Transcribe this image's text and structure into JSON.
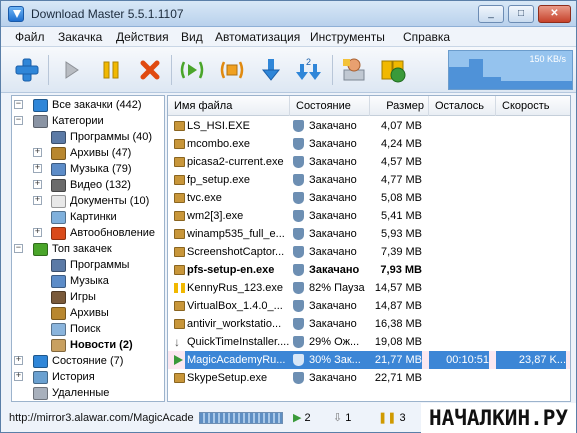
{
  "window": {
    "title": "Download Master 5.5.1.1107"
  },
  "titlebar_buttons": {
    "minimize": "_",
    "maximize": "□",
    "close": "✕"
  },
  "menu": [
    "Файл",
    "Закачка",
    "Действия",
    "Вид",
    "Автоматизация",
    "Инструменты",
    "Справка"
  ],
  "toolbar": {
    "icons": [
      "add-icon",
      "resume-icon",
      "pause-icon",
      "delete-icon",
      "start-all-icon",
      "stop-all-icon",
      "download-icon",
      "download-queue-icon",
      "site-manager-icon",
      "scheduler-icon"
    ]
  },
  "speed": {
    "label": "150 KB/s"
  },
  "tree": {
    "items": [
      {
        "label": "Все закачки (442)",
        "icon": "all-downloads-icon",
        "expander": "−",
        "level": 0,
        "bold": false
      },
      {
        "label": "Категории",
        "icon": "categories-icon",
        "expander": "−",
        "level": 0,
        "bold": false
      },
      {
        "label": "Программы (40)",
        "icon": "programs-icon",
        "expander": "",
        "level": 1,
        "bold": false
      },
      {
        "label": "Архивы (47)",
        "icon": "archives-icon",
        "expander": "+",
        "level": 1,
        "bold": false
      },
      {
        "label": "Музыка (79)",
        "icon": "music-icon",
        "expander": "+",
        "level": 1,
        "bold": false
      },
      {
        "label": "Видео (132)",
        "icon": "video-icon",
        "expander": "+",
        "level": 1,
        "bold": false
      },
      {
        "label": "Документы (10)",
        "icon": "documents-icon",
        "expander": "+",
        "level": 1,
        "bold": false
      },
      {
        "label": "Картинки",
        "icon": "pictures-icon",
        "expander": "",
        "level": 1,
        "bold": false
      },
      {
        "label": "Автообновление",
        "icon": "autoupdate-icon",
        "expander": "+",
        "level": 1,
        "bold": false
      },
      {
        "label": "Топ закачек",
        "icon": "top-downloads-icon",
        "expander": "−",
        "level": 0,
        "bold": false
      },
      {
        "label": "Программы",
        "icon": "programs-icon",
        "expander": "",
        "level": 1,
        "bold": false
      },
      {
        "label": "Музыка",
        "icon": "music-icon",
        "expander": "",
        "level": 1,
        "bold": false
      },
      {
        "label": "Игры",
        "icon": "games-icon",
        "expander": "",
        "level": 1,
        "bold": false
      },
      {
        "label": "Архивы",
        "icon": "archives-icon",
        "expander": "",
        "level": 1,
        "bold": false
      },
      {
        "label": "Поиск",
        "icon": "search-icon",
        "expander": "",
        "level": 1,
        "bold": false
      },
      {
        "label": "Новости (2)",
        "icon": "news-icon",
        "expander": "",
        "level": 1,
        "bold": true
      },
      {
        "label": "Состояние (7)",
        "icon": "status-icon",
        "expander": "+",
        "level": 0,
        "bold": false
      },
      {
        "label": "История",
        "icon": "history-icon",
        "expander": "+",
        "level": 0,
        "bold": false
      },
      {
        "label": "Удаленные",
        "icon": "trash-icon",
        "expander": "",
        "level": 0,
        "bold": false
      }
    ]
  },
  "table": {
    "columns": [
      "Имя файла",
      "Состояние",
      "Размер",
      "Осталось",
      "Скорость"
    ],
    "rows": [
      {
        "name": "LS_HSI.EXE",
        "state": "Закачано",
        "size": "4,07 MB",
        "left": "",
        "speed": "",
        "kind": "done"
      },
      {
        "name": "mcombo.exe",
        "state": "Закачано",
        "size": "4,24 MB",
        "left": "",
        "speed": "",
        "kind": "done"
      },
      {
        "name": "picasa2-current.exe",
        "state": "Закачано",
        "size": "4,57 MB",
        "left": "",
        "speed": "",
        "kind": "done"
      },
      {
        "name": "fp_setup.exe",
        "state": "Закачано",
        "size": "4,77 MB",
        "left": "",
        "speed": "",
        "kind": "done"
      },
      {
        "name": "tvc.exe",
        "state": "Закачано",
        "size": "5,08 MB",
        "left": "",
        "speed": "",
        "kind": "done"
      },
      {
        "name": "wm2[3].exe",
        "state": "Закачано",
        "size": "5,41 MB",
        "left": "",
        "speed": "",
        "kind": "done"
      },
      {
        "name": "winamp535_full_e...",
        "state": "Закачано",
        "size": "5,93 MB",
        "left": "",
        "speed": "",
        "kind": "done"
      },
      {
        "name": "ScreenshotCaptor...",
        "state": "Закачано",
        "size": "7,39 MB",
        "left": "",
        "speed": "",
        "kind": "done"
      },
      {
        "name": "pfs-setup-en.exe",
        "state": "Закачано",
        "size": "7,93 MB",
        "left": "",
        "speed": "",
        "kind": "bold"
      },
      {
        "name": "KennyRus_123.exe",
        "state": "82% Пауза",
        "size": "14,57 MB",
        "left": "",
        "speed": "",
        "kind": "paused"
      },
      {
        "name": "VirtualBox_1.4.0_...",
        "state": "Закачано",
        "size": "14,87 MB",
        "left": "",
        "speed": "",
        "kind": "done"
      },
      {
        "name": "antivir_workstatio...",
        "state": "Закачано",
        "size": "16,38 MB",
        "left": "",
        "speed": "",
        "kind": "done"
      },
      {
        "name": "QuickTimeInstaller....",
        "state": "29% Ож...",
        "size": "19,08 MB",
        "left": "",
        "speed": "",
        "kind": "waiting"
      },
      {
        "name": "MagicAcademyRu...",
        "state": "30% Зак...",
        "size": "21,77 MB",
        "left": "00:10:51",
        "speed": "23,87 K...",
        "kind": "active"
      },
      {
        "name": "SkypeSetup.exe",
        "state": "Закачано",
        "size": "22,71 MB",
        "left": "",
        "speed": "",
        "kind": "done"
      }
    ]
  },
  "statusbar": {
    "url": "http://mirror3.alawar.com/MagicAcade",
    "active_count": "2",
    "queued_count": "1",
    "paused_count": "3"
  },
  "watermark": "НАЧАЛКИН.РУ",
  "colors": {
    "selection": "#3c86d6",
    "accent": "#2f73c9"
  }
}
